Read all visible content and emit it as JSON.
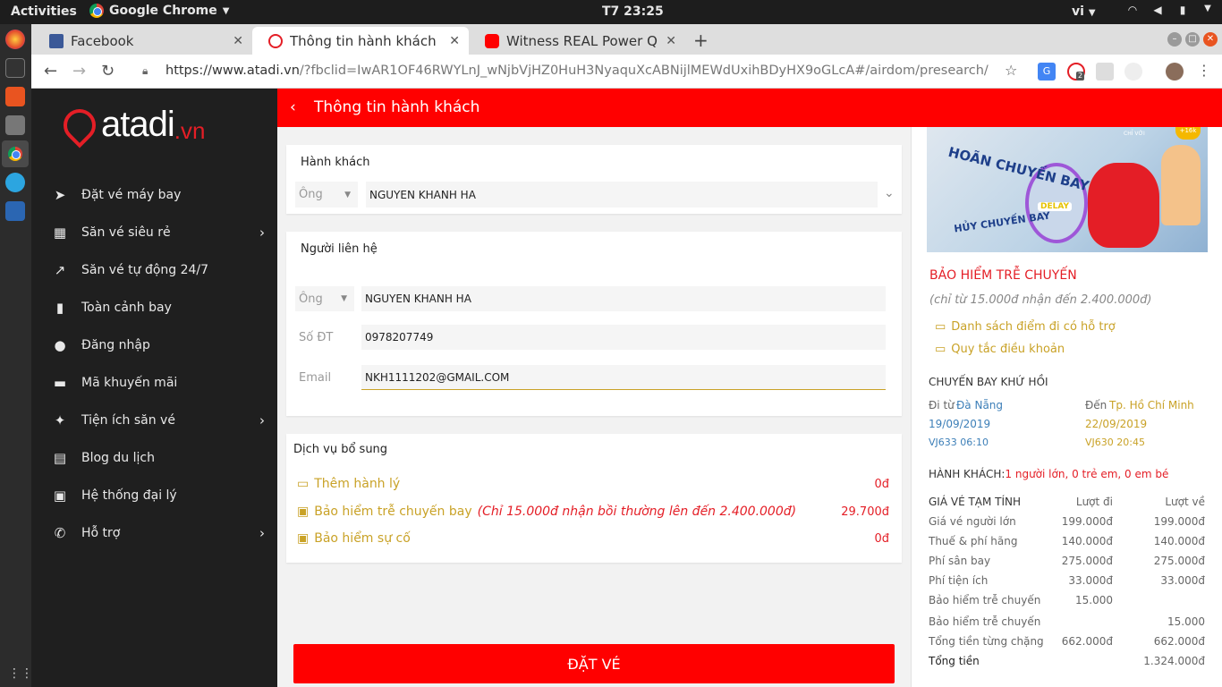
{
  "os": {
    "activities": "Activities",
    "app_name": "Google Chrome",
    "clock": "T7 23:25",
    "lang": "vi"
  },
  "tabs": [
    {
      "title": "Facebook",
      "close": "✕"
    },
    {
      "title": "Thông tin hành khách",
      "close": "✕"
    },
    {
      "title": "Witness REAL Power QIYANA",
      "close": "✕"
    }
  ],
  "newtab": "+",
  "addressbar": {
    "url_domain": "https://www.atadi.vn",
    "url_rest": "/?fbclid=IwAR1OF46RWYLnJ_wNjbVjHZ0HuH3NyaquXcABNijlMEWdUxihBDyHX9oGLcA#/airdom/presearch/search_passen...",
    "ext_badge": "2"
  },
  "brand": {
    "word": "atadi",
    "tld": ".vn"
  },
  "sidebar": {
    "items": [
      {
        "label": "Đặt vé máy bay",
        "icon": "➤",
        "chevron": ""
      },
      {
        "label": "Săn vé siêu rẻ",
        "icon": "▦",
        "chevron": "›"
      },
      {
        "label": "Săn vé tự động 24/7",
        "icon": "↗",
        "chevron": ""
      },
      {
        "label": "Toàn cảnh bay",
        "icon": "▮",
        "chevron": ""
      },
      {
        "label": "Đăng nhập",
        "icon": "●",
        "chevron": ""
      },
      {
        "label": "Mã khuyến mãi",
        "icon": "▬",
        "chevron": ""
      },
      {
        "label": "Tiện ích săn vé",
        "icon": "✦",
        "chevron": "›"
      },
      {
        "label": "Blog du lịch",
        "icon": "▤",
        "chevron": ""
      },
      {
        "label": "Hệ thống đại lý",
        "icon": "▣",
        "chevron": ""
      },
      {
        "label": "Hỗ trợ",
        "icon": "✆",
        "chevron": "›"
      }
    ]
  },
  "header": {
    "back": "‹",
    "title": "Thông tin hành khách"
  },
  "passenger": {
    "heading": "Hành khách",
    "title_value": "Ông",
    "name": "NGUYEN KHANH HA",
    "expand": "⌄"
  },
  "contact": {
    "heading": "Người liên hệ",
    "title_value": "Ông",
    "name": "NGUYEN KHANH HA",
    "phone_label": "Số ĐT",
    "phone": "0978207749",
    "email_label": "Email",
    "email": "NKH1111202@GMAIL.COM"
  },
  "services": {
    "heading": "Dịch vụ bổ sung",
    "items": [
      {
        "label": "Thêm hành lý",
        "promo": "",
        "price": "0đ"
      },
      {
        "label": "Bảo hiểm trễ chuyến bay",
        "promo": "(Chỉ 15.000đ nhận bồi thường lên đến 2.400.000đ)",
        "price": "29.700đ"
      },
      {
        "label": "Bảo hiểm sự cố",
        "promo": "",
        "price": "0đ"
      }
    ]
  },
  "book_button": "ĐẶT VÉ",
  "banner": {
    "line1": "HOÃN CHUYẾN BAY",
    "line2": "HỦY CHUYẾN BAY",
    "delay": "DELAY",
    "small": "CHỈ VỚI",
    "tag": "+16k"
  },
  "insurance": {
    "title": "BẢO HIỂM TRỄ CHUYẾN",
    "subtitle": "(chỉ từ 15.000đ nhận đến 2.400.000đ)",
    "links": [
      "Danh sách điểm đi có hỗ trợ",
      "Quy tắc điều khoản"
    ]
  },
  "trip": {
    "heading": "CHUYẾN BAY KHỨ HỒI",
    "from_label": "Đi từ",
    "from": "Đà Nẵng",
    "to_label": "Đến",
    "to": "Tp. Hồ Chí Minh",
    "depart_date": "19/09/2019",
    "return_date": "22/09/2019",
    "depart_flight": "VJ633  06:10",
    "return_flight": "VJ630  20:45"
  },
  "pax": {
    "label": "HÀNH KHÁCH:",
    "value": "1 người lớn, 0 trẻ em, 0 em bé"
  },
  "fare": {
    "heading": "GIÁ VÉ TẠM TÍNH",
    "col_out": "Lượt đi",
    "col_ret": "Lượt về",
    "rows": [
      {
        "label": "Giá vé người lớn",
        "out": "199.000đ",
        "ret": "199.000đ"
      },
      {
        "label": "Thuế & phí hãng",
        "out": "140.000đ",
        "ret": "140.000đ"
      },
      {
        "label": "Phí sân bay",
        "out": "275.000đ",
        "ret": "275.000đ"
      },
      {
        "label": "Phí tiện ích",
        "out": "33.000đ",
        "ret": "33.000đ"
      },
      {
        "label": "Bảo hiểm trễ chuyến",
        "out": "15.000",
        "ret": ""
      },
      {
        "label": "Bảo hiểm trễ chuyến",
        "out": "",
        "ret": "15.000"
      }
    ],
    "leg_total_label": "Tổng tiền từng chặng",
    "leg_total_out": "662.000đ",
    "leg_total_ret": "662.000đ",
    "total_label": "Tổng tiền",
    "total": "1.324.000đ"
  },
  "colors": {
    "brand_red": "#ff0000",
    "gold": "#c9a227",
    "blue": "#3d7fb8",
    "sidebar": "#1f1f1f"
  }
}
